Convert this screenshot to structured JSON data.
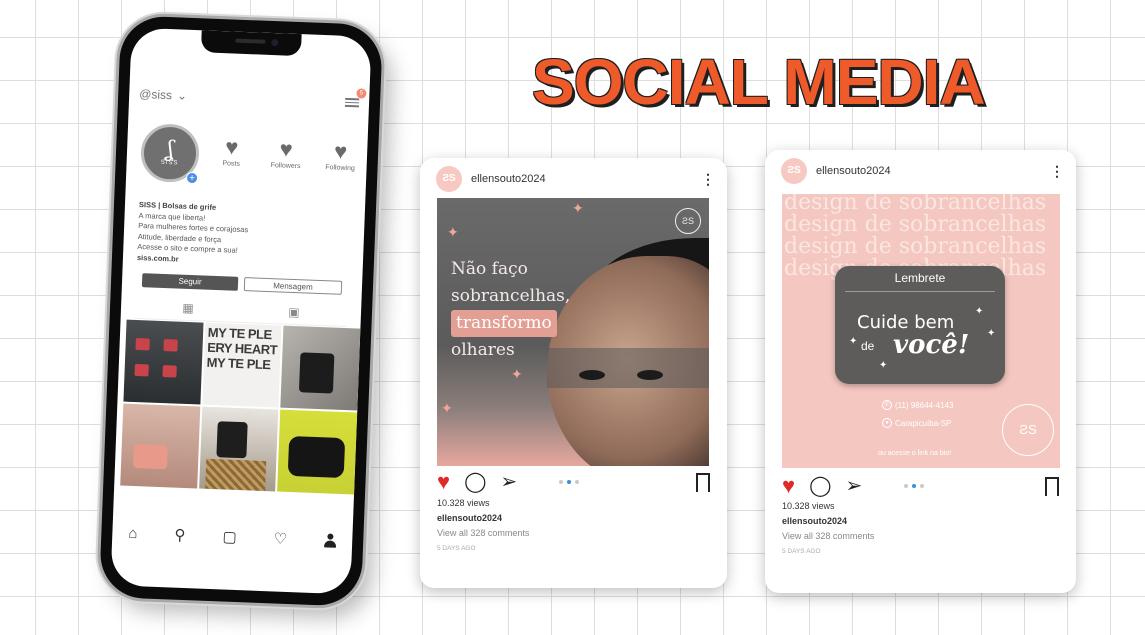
{
  "title": "SOCIAL MEDIA",
  "colors": {
    "accent": "#ee5a2a",
    "pink": "#f4c7c0",
    "dark": "#5e5c5b"
  },
  "phone": {
    "handle": "@siss",
    "notification_count": "5",
    "avatar_mark": "ʆ",
    "avatar_name": "SISS",
    "stats": [
      {
        "icon": "heart-icon",
        "label": "Posts"
      },
      {
        "icon": "heart-icon",
        "label": "Followers"
      },
      {
        "icon": "heart-icon",
        "label": "Following"
      }
    ],
    "bio": {
      "name": "SISS | Bolsas de grife",
      "lines": [
        "A marca que liberta!",
        "Para mulheres fortes e corajosas",
        "Atitude, liberdade e força",
        "Acesse o sito e compre a sua!"
      ],
      "link": "siss.com.br"
    },
    "follow_label": "Seguir",
    "message_label": "Mensagem",
    "grid_photo_text": "MY TE PLE ERY HEART MY TE PLE",
    "nav": [
      "home-icon",
      "search-icon",
      "reels-icon",
      "heart-icon",
      "profile-icon"
    ]
  },
  "post1": {
    "avatar": "ƧS",
    "username": "ellensouto2024",
    "headline": {
      "line1": "Não faço",
      "line2": "sobrancelhas,",
      "line3": "transformo",
      "line4": "olhares"
    },
    "logo": "ƧS",
    "views": "10.328 views",
    "author": "ellensouto2024",
    "comments": "View all 328 comments",
    "date": "5 DAYS AGO"
  },
  "post2": {
    "avatar": "ƧS",
    "username": "ellensouto2024",
    "bg_lines": [
      "design de sobrancelhas",
      "design de sobrancelhas",
      "design de sobrancelhas",
      "design de sobrancelhas"
    ],
    "card_title": "Lembrete",
    "cta_line1": "Cuide bem",
    "cta_line2": "de",
    "cta_line3": "você!",
    "phone": "(11) 98644-4143",
    "location": "Carapicuíba-SP",
    "footer": "ou acesse o link na bio!",
    "seal": "ƧS",
    "views": "10.328 views",
    "author": "ellensouto2024",
    "comments": "View all 328 comments",
    "date": "5 DAYS AGO"
  }
}
